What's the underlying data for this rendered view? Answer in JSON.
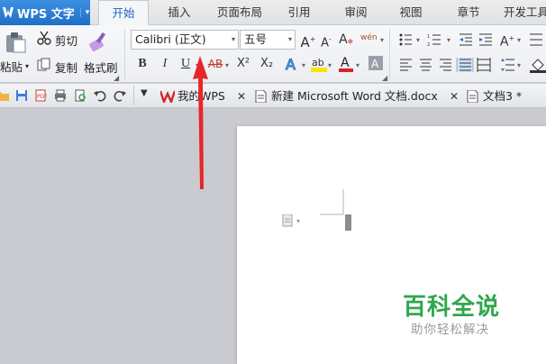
{
  "app": {
    "name": "WPS 文字",
    "menu_arrow": "▾"
  },
  "tabs": [
    "开始",
    "插入",
    "页面布局",
    "引用",
    "审阅",
    "视图",
    "章节",
    "开发工具"
  ],
  "clipboard": {
    "paste": "粘贴",
    "cut": "剪切",
    "copy": "复制",
    "format_painter": "格式刷"
  },
  "font": {
    "family": "Calibri (正文)",
    "size": "五号",
    "grow": "A",
    "shrink": "A",
    "clear": "A",
    "phonetic": "wén"
  },
  "format_buttons": {
    "bold": "B",
    "italic": "I",
    "underline": "U",
    "strike": "AB",
    "superscript": "X²",
    "subscript": "X₂"
  },
  "doc_tabs": [
    {
      "label": "我的WPS"
    },
    {
      "label": "新建 Microsoft Word 文档.docx"
    },
    {
      "label": "文档3 *"
    }
  ],
  "watermark": {
    "title": "百科全说",
    "subtitle": "助你轻松解决"
  },
  "colors": {
    "accent": "#1f6fc9",
    "arrow": "#e8262a",
    "highlight": "#f5e800",
    "fontcolor": "#d42424",
    "watermark": "#2fa74b"
  }
}
